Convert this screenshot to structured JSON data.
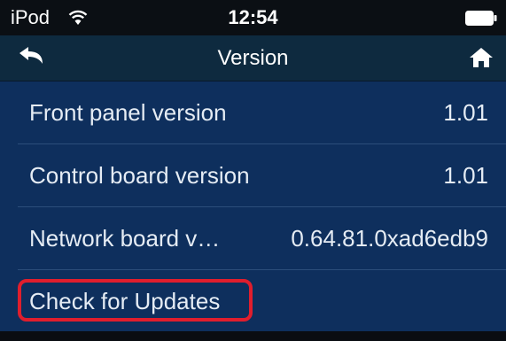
{
  "status_bar": {
    "carrier": "iPod",
    "time": "12:54",
    "wifi_icon": "wifi-icon",
    "battery_icon": "battery-full-icon"
  },
  "nav": {
    "title": "Version",
    "back_icon": "back-arrow-icon",
    "home_icon": "home-icon"
  },
  "rows": [
    {
      "label": "Front panel version",
      "value": "1.01"
    },
    {
      "label": "Control board version",
      "value": "1.01"
    },
    {
      "label": "Network board v…",
      "value": "0.64.81.0xad6edb9"
    }
  ],
  "check_updates": {
    "label": "Check for Updates"
  },
  "colors": {
    "background": "#0e2f5d",
    "nav_bar": "#0e2a3f",
    "status_bar": "#0b0f14",
    "highlight": "#e01e2d",
    "text": "#e5ecf4"
  }
}
